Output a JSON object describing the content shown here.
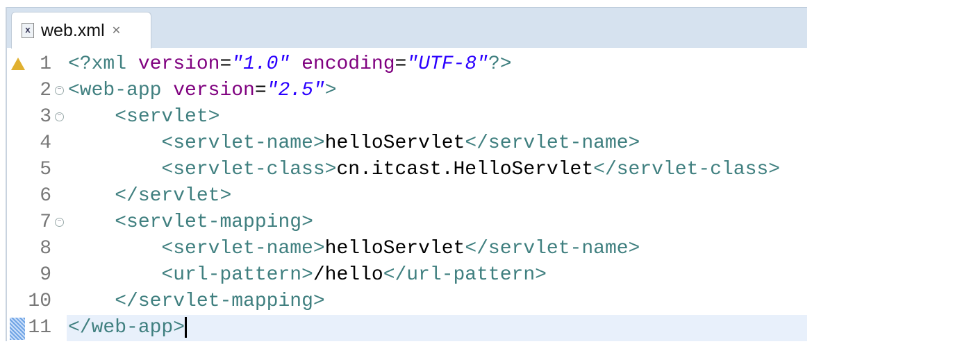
{
  "tab": {
    "title": "web.xml",
    "icon": "xml-file-icon",
    "close_icon": "close-icon"
  },
  "colors": {
    "tag": "#3f7f7f",
    "attribute": "#7f007f",
    "value": "#2a00ff",
    "text": "#000000",
    "current_line": "#e8f0fb"
  },
  "lines": [
    {
      "n": "1",
      "marker": "warning",
      "tokens": [
        [
          "tag",
          "<?xml "
        ],
        [
          "attr",
          "version"
        ],
        [
          "plain",
          "="
        ],
        [
          "val",
          "\"1.0\""
        ],
        [
          "plain",
          " "
        ],
        [
          "attr",
          "encoding"
        ],
        [
          "plain",
          "="
        ],
        [
          "val",
          "\"UTF-8\""
        ],
        [
          "tag",
          "?>"
        ]
      ]
    },
    {
      "n": "2",
      "fold": true,
      "tokens": [
        [
          "tag",
          "<web-app "
        ],
        [
          "attr",
          "version"
        ],
        [
          "plain",
          "="
        ],
        [
          "val",
          "\"2.5\""
        ],
        [
          "tag",
          ">"
        ]
      ]
    },
    {
      "n": "3",
      "fold": true,
      "tokens": [
        [
          "plain",
          "    "
        ],
        [
          "tag",
          "<servlet>"
        ]
      ]
    },
    {
      "n": "4",
      "tokens": [
        [
          "plain",
          "        "
        ],
        [
          "tag",
          "<servlet-name>"
        ],
        [
          "plain",
          "helloServlet"
        ],
        [
          "tag",
          "</servlet-name>"
        ]
      ]
    },
    {
      "n": "5",
      "tokens": [
        [
          "plain",
          "        "
        ],
        [
          "tag",
          "<servlet-class>"
        ],
        [
          "plain",
          "cn.itcast.HelloServlet"
        ],
        [
          "tag",
          "</servlet-class>"
        ]
      ]
    },
    {
      "n": "6",
      "tokens": [
        [
          "plain",
          "    "
        ],
        [
          "tag",
          "</servlet>"
        ]
      ]
    },
    {
      "n": "7",
      "fold": true,
      "tokens": [
        [
          "plain",
          "    "
        ],
        [
          "tag",
          "<servlet-mapping>"
        ]
      ]
    },
    {
      "n": "8",
      "tokens": [
        [
          "plain",
          "        "
        ],
        [
          "tag",
          "<servlet-name>"
        ],
        [
          "plain",
          "helloServlet"
        ],
        [
          "tag",
          "</servlet-name>"
        ]
      ]
    },
    {
      "n": "9",
      "tokens": [
        [
          "plain",
          "        "
        ],
        [
          "tag",
          "<url-pattern>"
        ],
        [
          "plain",
          "/hello"
        ],
        [
          "tag",
          "</url-pattern>"
        ]
      ]
    },
    {
      "n": "10",
      "tokens": [
        [
          "plain",
          "    "
        ],
        [
          "tag",
          "</servlet-mapping>"
        ]
      ]
    },
    {
      "n": "11",
      "marker": "bookmark",
      "current": true,
      "tokens": [
        [
          "tag",
          "</web-app>"
        ]
      ]
    }
  ]
}
